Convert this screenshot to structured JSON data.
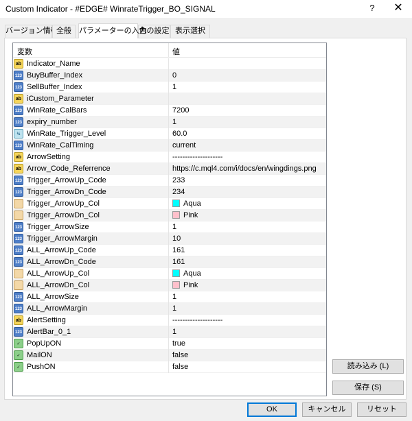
{
  "window": {
    "title": "Custom Indicator - #EDGE# WinrateTrigger_BO_SIGNAL",
    "help_glyph": "?",
    "close_glyph": "✕"
  },
  "tabs": [
    {
      "label": "バージョン情報",
      "active": false
    },
    {
      "label": "全般",
      "active": false
    },
    {
      "label": "パラメーターの入力",
      "active": true
    },
    {
      "label": "色の設定",
      "active": false
    },
    {
      "label": "表示選択",
      "active": false
    }
  ],
  "grid": {
    "col_variable": "変数",
    "col_value": "値",
    "rows": [
      {
        "type": "ab",
        "name": "Indicator_Name",
        "value": ""
      },
      {
        "type": "123",
        "name": "BuyBuffer_Index",
        "value": "0"
      },
      {
        "type": "123",
        "name": "SellBuffer_Index",
        "value": "1"
      },
      {
        "type": "ab",
        "name": "iCustom_Parameter",
        "value": ""
      },
      {
        "type": "123",
        "name": "WinRate_CalBars",
        "value": "7200"
      },
      {
        "type": "123",
        "name": "expiry_number",
        "value": "1"
      },
      {
        "type": "v2",
        "name": "WinRate_Trigger_Level",
        "value": "60.0"
      },
      {
        "type": "123",
        "name": "WinRate_CalTiming",
        "value": "current"
      },
      {
        "type": "ab",
        "name": "ArrowSetting",
        "value": "--------------------"
      },
      {
        "type": "ab",
        "name": "Arrow_Code_Referrence",
        "value": "https://c.mql4.com/i/docs/en/wingdings.png"
      },
      {
        "type": "123",
        "name": "Trigger_ArrowUp_Code",
        "value": "233"
      },
      {
        "type": "123",
        "name": "Trigger_ArrowDn_Code",
        "value": "234"
      },
      {
        "type": "col",
        "name": "Trigger_ArrowUp_Col",
        "value": "Aqua",
        "color": "#00ffff"
      },
      {
        "type": "col",
        "name": "Trigger_ArrowDn_Col",
        "value": "Pink",
        "color": "#ffc0cb"
      },
      {
        "type": "123",
        "name": "Trigger_ArrowSize",
        "value": "1"
      },
      {
        "type": "123",
        "name": "Trigger_ArrowMargin",
        "value": "10"
      },
      {
        "type": "123",
        "name": "ALL_ArrowUp_Code",
        "value": "161"
      },
      {
        "type": "123",
        "name": "ALL_ArrowDn_Code",
        "value": "161"
      },
      {
        "type": "col",
        "name": "ALL_ArrowUp_Col",
        "value": "Aqua",
        "color": "#00ffff"
      },
      {
        "type": "col",
        "name": "ALL_ArrowDn_Col",
        "value": "Pink",
        "color": "#ffc0cb"
      },
      {
        "type": "123",
        "name": "ALL_ArrowSize",
        "value": "1"
      },
      {
        "type": "123",
        "name": "ALL_ArrowMargin",
        "value": "1"
      },
      {
        "type": "ab",
        "name": "AlertSetting",
        "value": "--------------------"
      },
      {
        "type": "123",
        "name": "AlertBar_0_1",
        "value": "1"
      },
      {
        "type": "bool",
        "name": "PopUpON",
        "value": "true"
      },
      {
        "type": "bool",
        "name": "MailON",
        "value": "false"
      },
      {
        "type": "bool",
        "name": "PushON",
        "value": "false"
      }
    ]
  },
  "icon_labels": {
    "ab": "ab",
    "123": "123",
    "v2": "½",
    "col": "",
    "bool": "✓"
  },
  "buttons": {
    "load": "読み込み (L)",
    "save": "保存 (S)",
    "ok": "OK",
    "cancel": "キャンセル",
    "reset": "リセット"
  }
}
